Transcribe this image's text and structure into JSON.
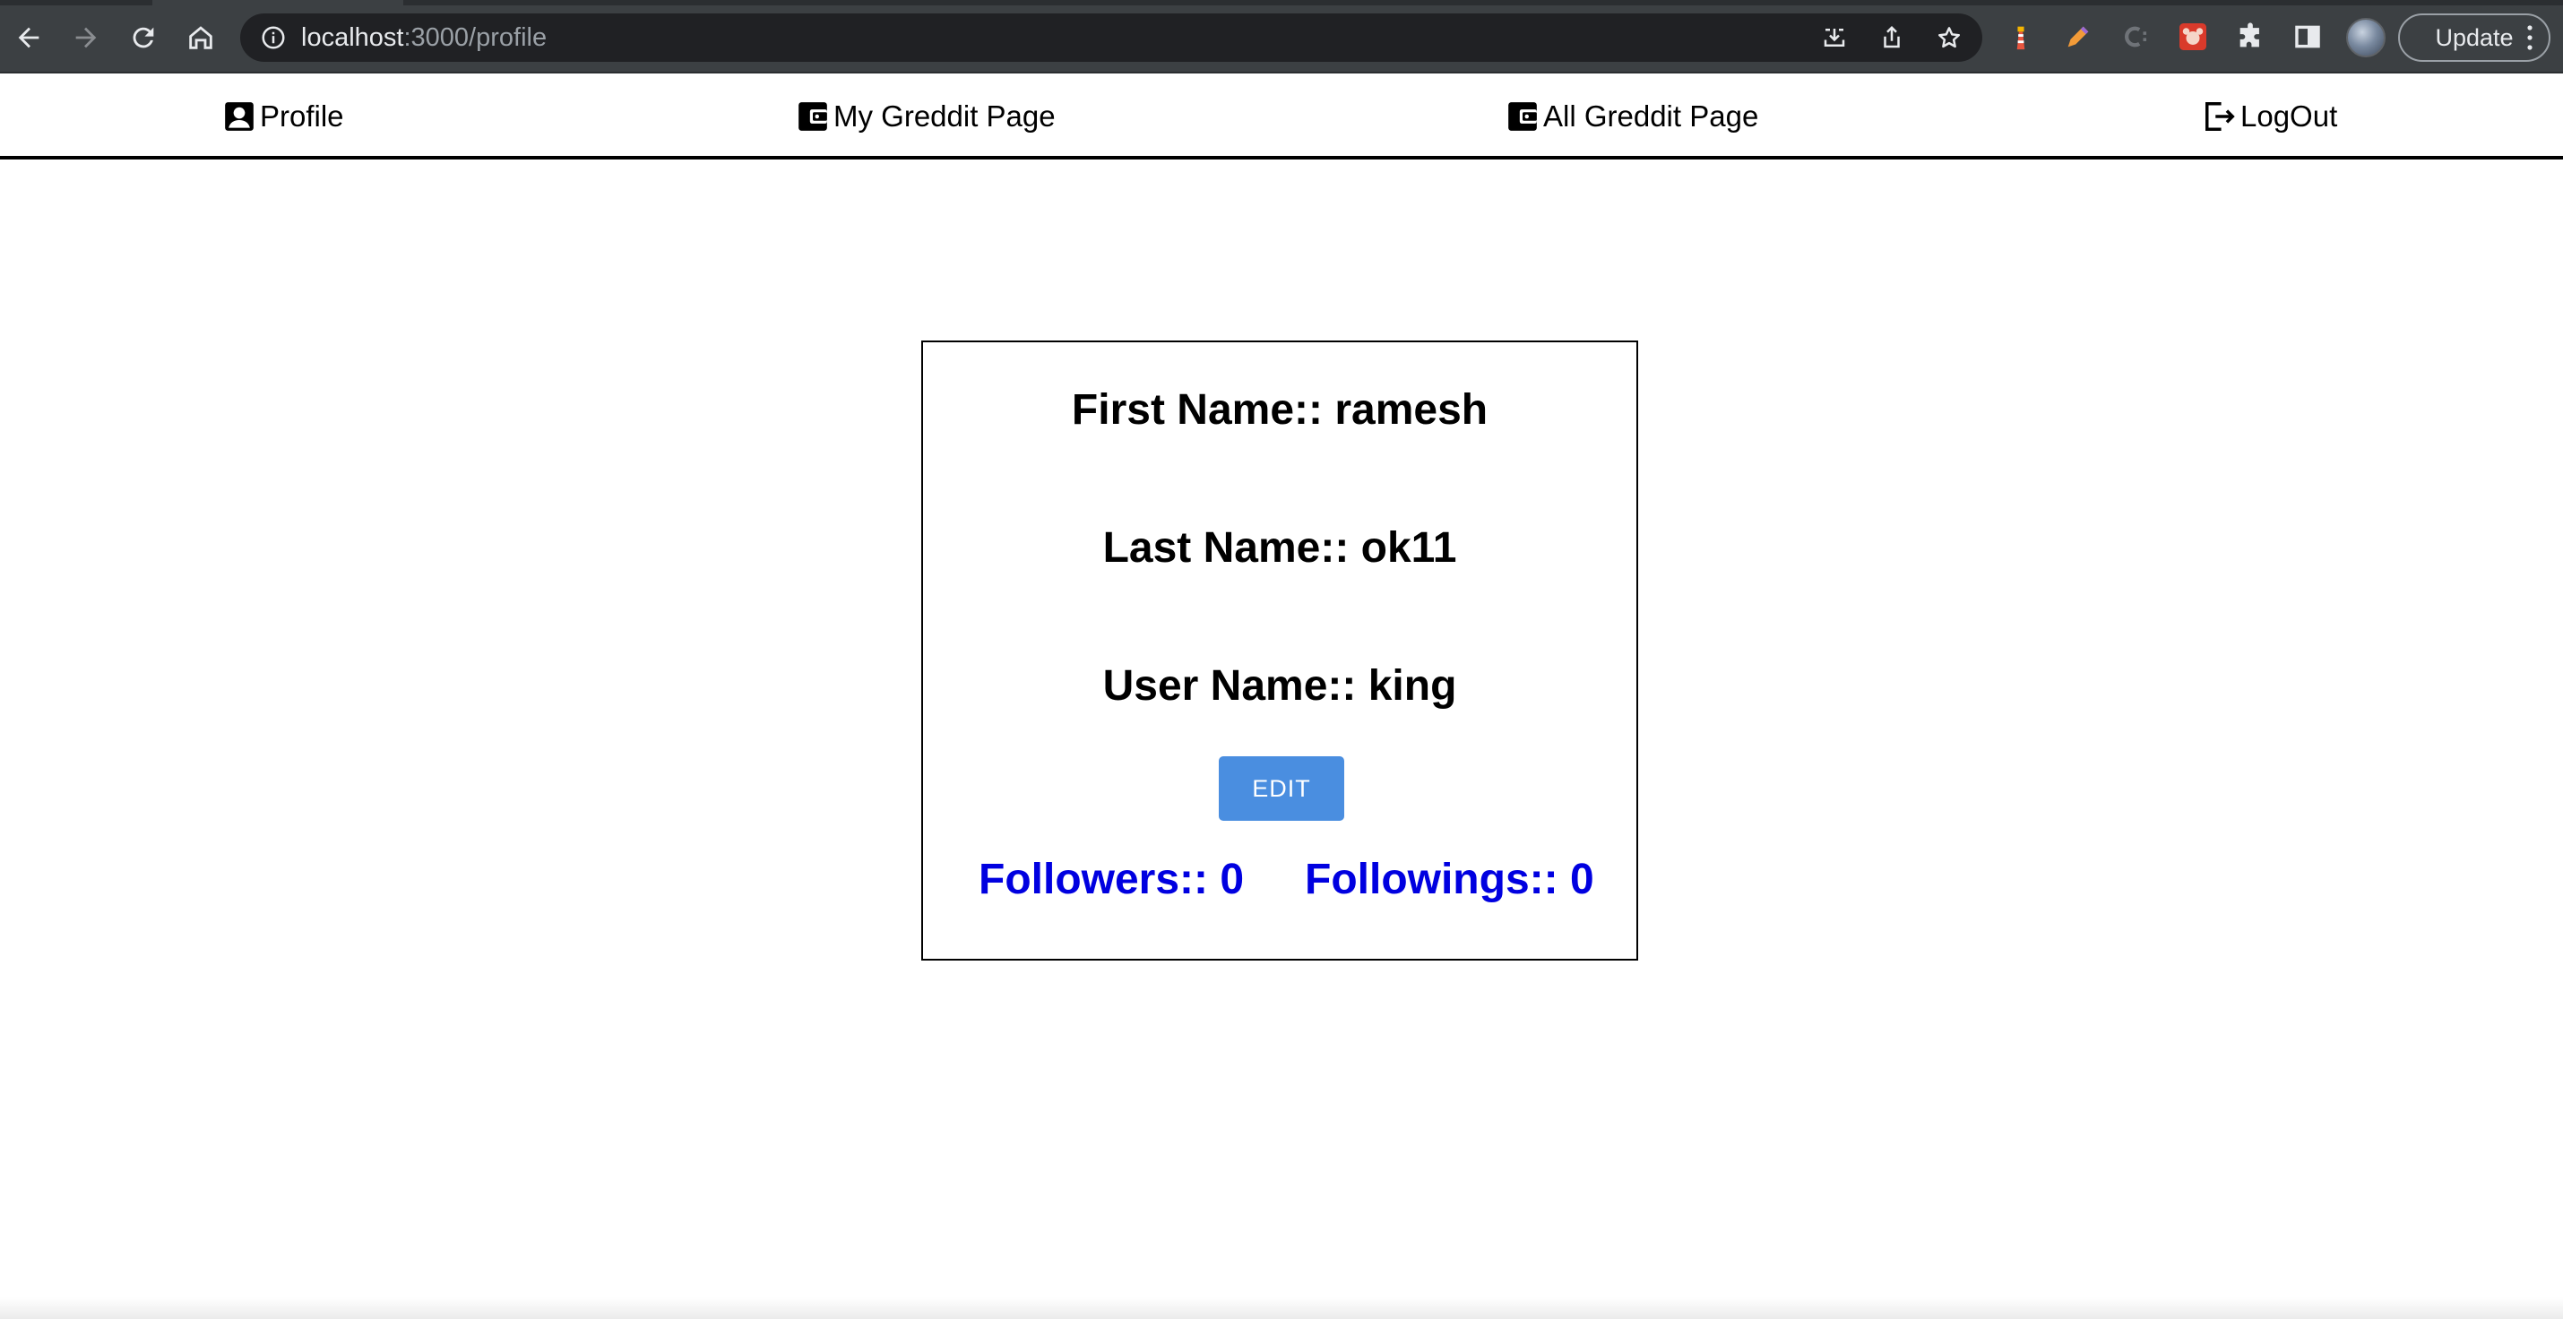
{
  "browser": {
    "url_host": "localhost",
    "url_path": ":3000/profile",
    "update_label": "Update"
  },
  "nav": {
    "profile": "Profile",
    "my_greddit": "My Greddit Page",
    "all_greddit": "All Greddit Page",
    "logout": "LogOut"
  },
  "profile": {
    "first_name": "First Name:: ramesh",
    "last_name": "Last Name:: ok11",
    "user_name": "User Name:: king",
    "edit_label": "EDIT",
    "followers": "Followers:: 0",
    "followings": "Followings:: 0"
  },
  "colors": {
    "edit_button": "#4a8ee0",
    "count_link": "#0000e0",
    "browser_bar": "#3c4043"
  },
  "icons": {
    "back": "arrow-left-icon",
    "forward": "arrow-right-icon",
    "reload": "reload-icon",
    "home": "home-icon",
    "info": "info-icon",
    "install": "install-icon",
    "share": "share-icon",
    "bookmark": "star-icon",
    "extensions": "puzzle-icon",
    "sidepanel": "side-panel-icon",
    "profile": "person-badge-icon",
    "wallet": "wallet-icon",
    "logout": "logout-icon"
  }
}
